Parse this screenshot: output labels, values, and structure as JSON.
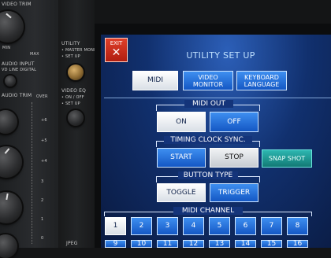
{
  "hardware": {
    "video_trim_label": "VIDEO TRIM",
    "min_label": "MIN",
    "max_label": "MAX",
    "audio_input_label": "AUDIO INPUT",
    "audio_input_options": "VD  LINE  DIGITAL",
    "audio_trim_label": "AUDIO TRIM",
    "over_label": "OVER",
    "utility_label": "UTILITY",
    "master_monitor_label": "• MASTER MONITOR",
    "set_up_label": "• SET UP",
    "video_eq_label": "VIDEO EQ",
    "video_eq_on_off_label": "• ON / OFF",
    "video_eq_set_up_label": "• SET UP",
    "jpeg_label": "JPEG",
    "scale_marks": [
      "+6",
      "+5",
      "+4",
      "3",
      "2",
      "1",
      "0"
    ]
  },
  "screen": {
    "exit_label": "EXIT",
    "exit_icon": "close-x",
    "title": "UTILITY SET UP",
    "tabs": [
      {
        "label": "MIDI",
        "selected": true
      },
      {
        "label": "VIDEO MONITOR",
        "selected": false
      },
      {
        "label": "KEYBOARD LANGUAGE",
        "selected": false
      }
    ],
    "midi_out": {
      "label": "MIDI OUT",
      "on_label": "ON",
      "off_label": "OFF",
      "selected": "OFF"
    },
    "timing_clock": {
      "label": "TIMING CLOCK SYNC.",
      "start_label": "START",
      "stop_label": "STOP",
      "snapshot_label": "SNAP SHOT"
    },
    "button_type": {
      "label": "BUTTON TYPE",
      "toggle_label": "TOGGLE",
      "trigger_label": "TRIGGER",
      "selected": "TRIGGER"
    },
    "midi_channel": {
      "label": "MIDI CHANNEL",
      "selected": "1",
      "row1": [
        "1",
        "2",
        "3",
        "4",
        "5",
        "6",
        "7",
        "8"
      ],
      "row2": [
        "9",
        "10",
        "11",
        "12",
        "13",
        "14",
        "15",
        "16"
      ]
    }
  },
  "colors": {
    "screen_bg": "#11306e",
    "button_blue": "#1f6fe0",
    "button_selected": "#ffffff",
    "exit_red": "#d0301c",
    "snapshot_teal": "#1f9a94"
  }
}
